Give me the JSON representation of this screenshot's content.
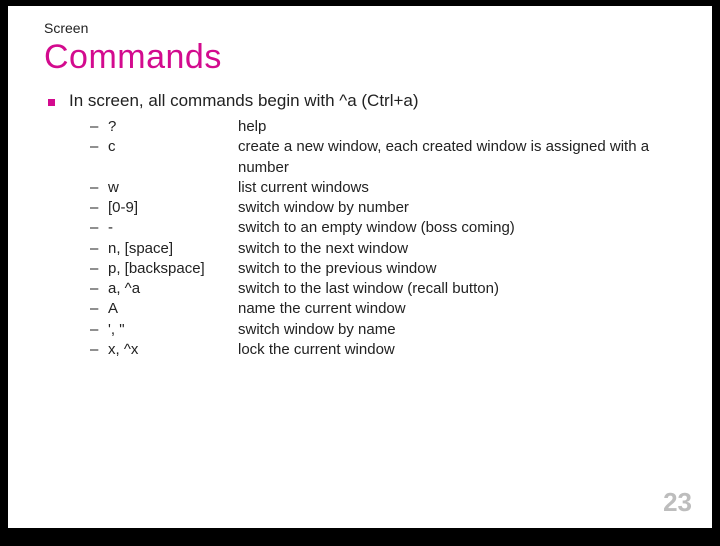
{
  "pretitle": "Screen",
  "title": "Commands",
  "lead": "In screen, all commands begin with ^a (Ctrl+a)",
  "dash": "–",
  "commands": [
    {
      "key": "?",
      "desc": "help"
    },
    {
      "key": "c",
      "desc": "create a new window, each created window is assigned with a number"
    },
    {
      "key": "w",
      "desc": "list current windows"
    },
    {
      "key": "[0-9]",
      "desc": "switch window by number"
    },
    {
      "key": "-",
      "desc": "switch to an empty window (boss coming)"
    },
    {
      "key": "n, [space]",
      "desc": "switch to the next window"
    },
    {
      "key": "p, [backspace]",
      "desc": "switch to the previous window"
    },
    {
      "key": "a, ^a",
      "desc": "switch to the last window (recall button)"
    },
    {
      "key": "A",
      "desc": "name the current window"
    },
    {
      "key": "', \"",
      "desc": "switch window by name"
    },
    {
      "key": "x, ^x",
      "desc": "lock the current window"
    }
  ],
  "page_number": "23"
}
